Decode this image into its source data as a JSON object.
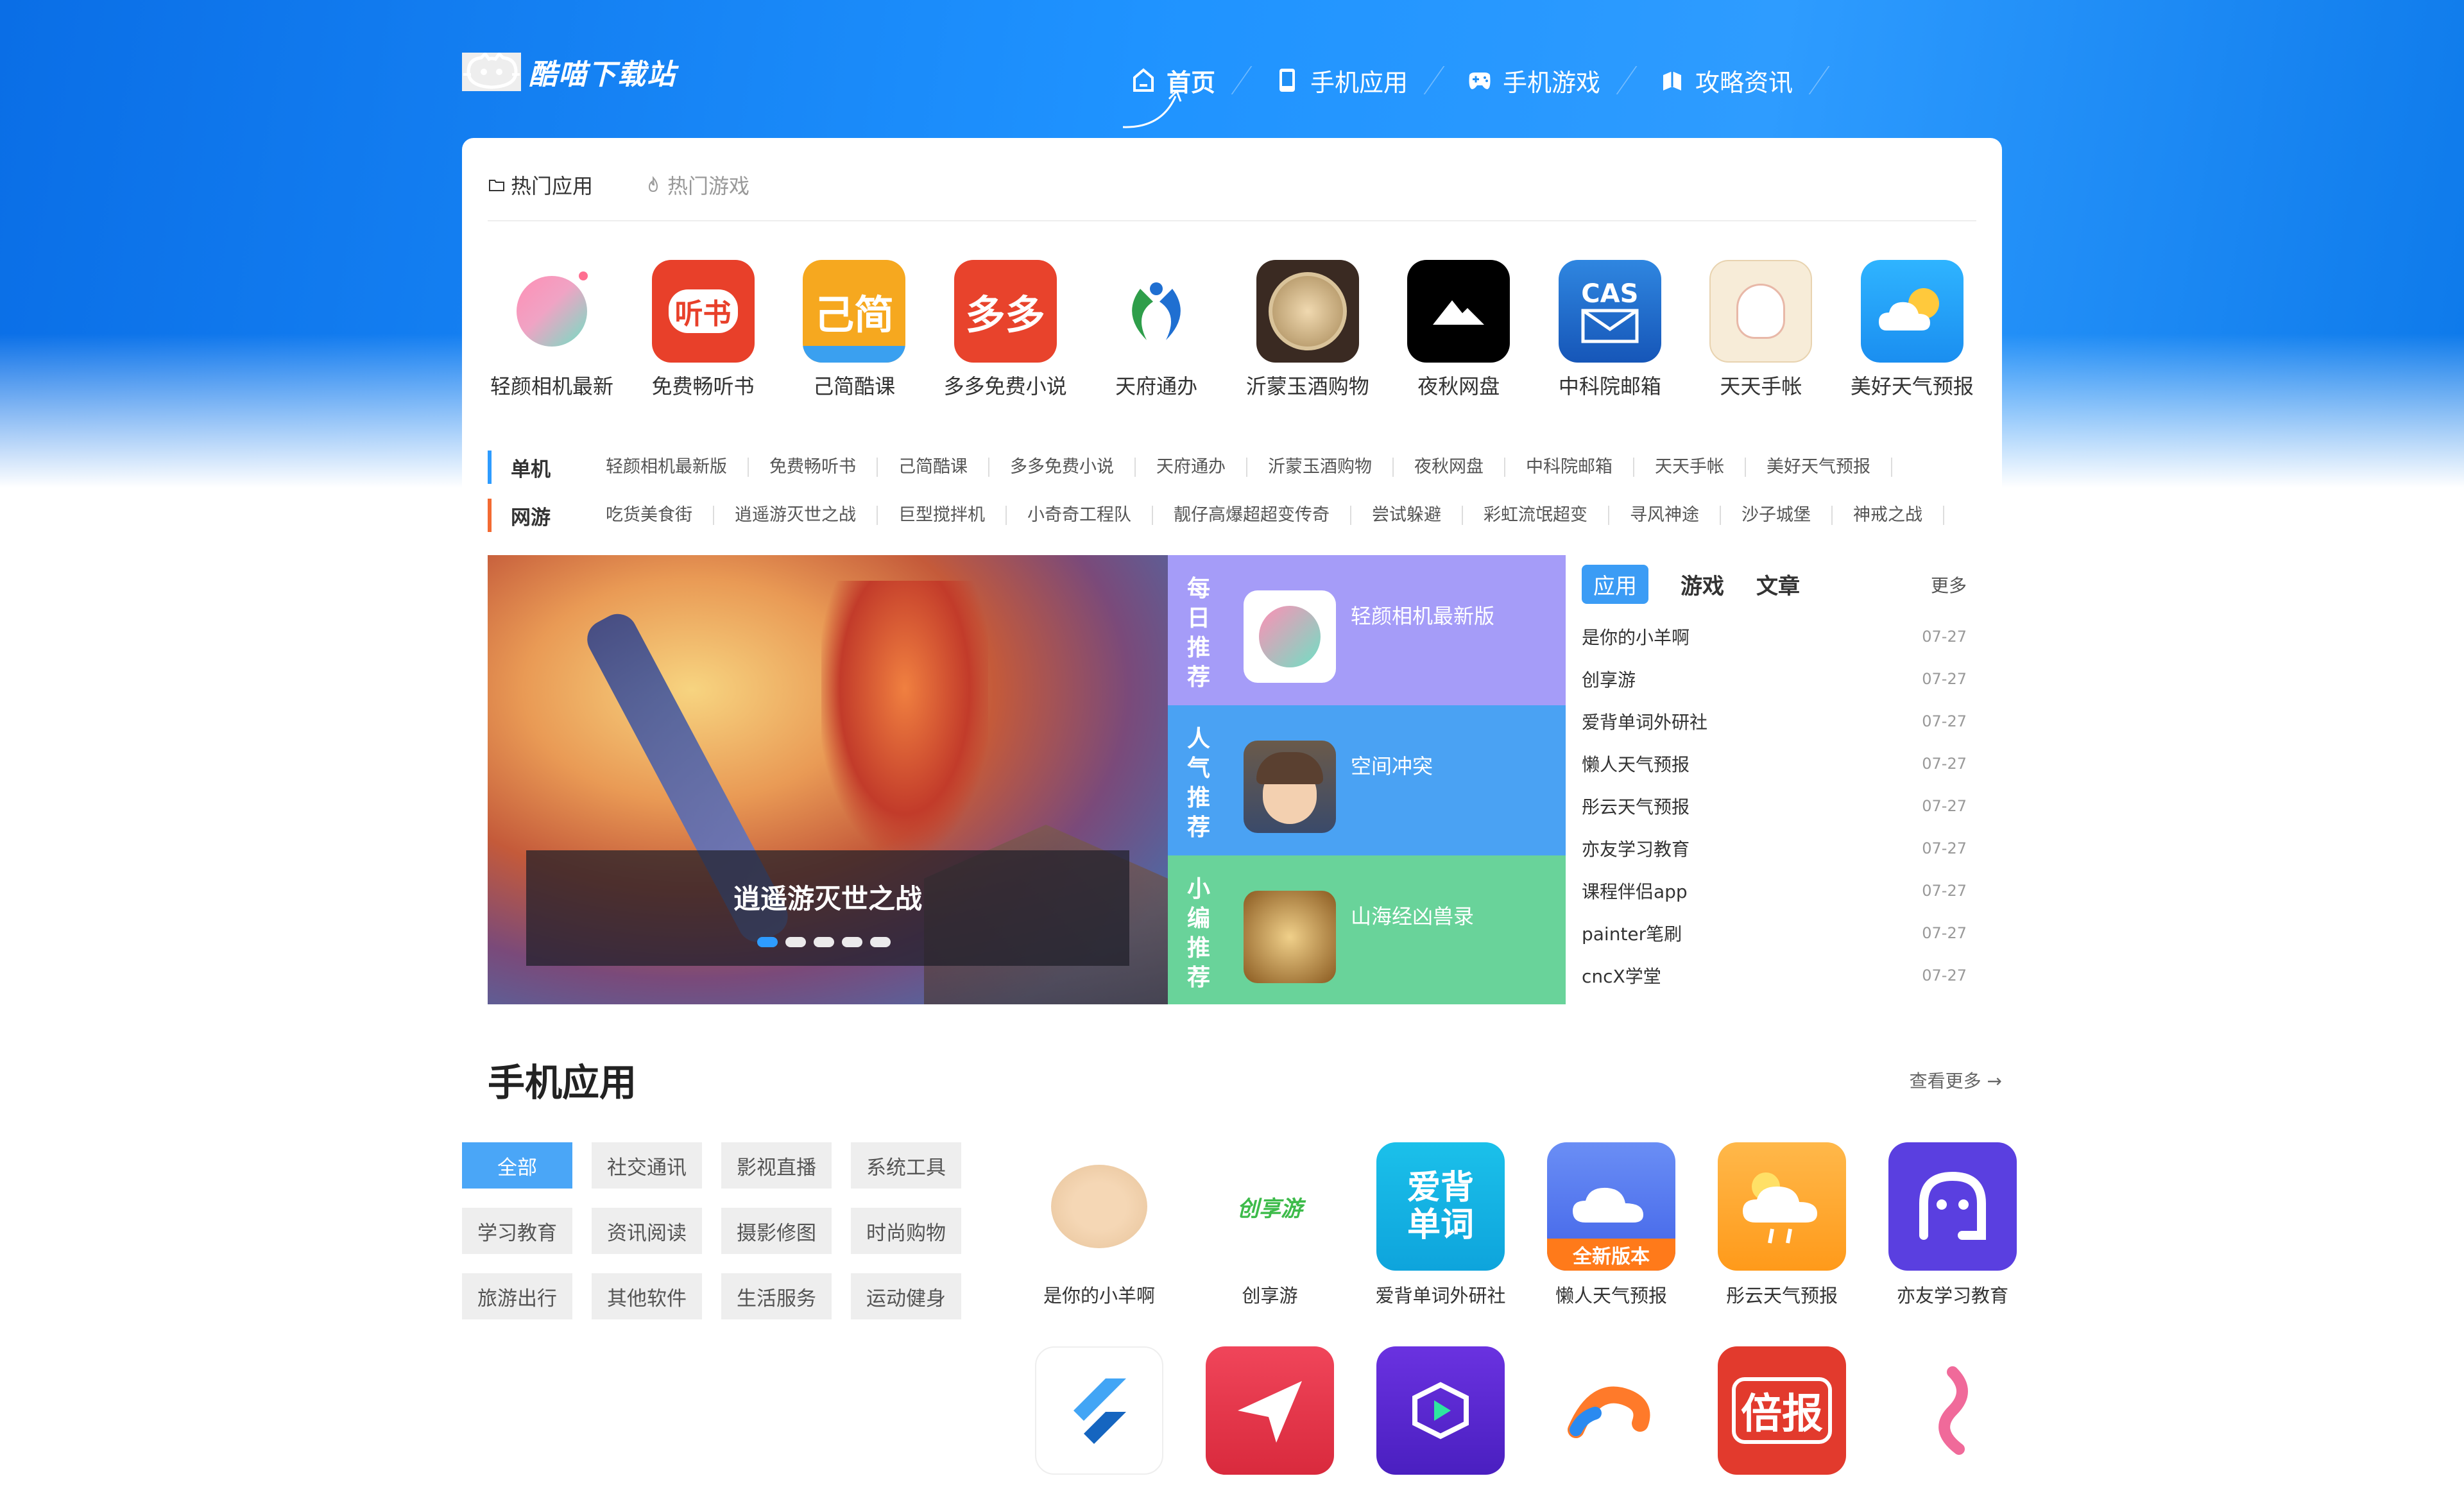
{
  "site": {
    "logo_text": "酷喵下载站"
  },
  "nav": [
    {
      "label": "首页",
      "icon": "home-icon"
    },
    {
      "label": "手机应用",
      "icon": "phone-icon"
    },
    {
      "label": "手机游戏",
      "icon": "gamepad-icon"
    },
    {
      "label": "攻略资讯",
      "icon": "book-icon"
    }
  ],
  "hot_tabs": [
    {
      "label": "热门应用",
      "icon": "folder-icon"
    },
    {
      "label": "热门游戏",
      "icon": "fire-icon"
    }
  ],
  "hot_apps": [
    {
      "label": "轻颜相机最新",
      "color": "#ffffff"
    },
    {
      "label": "免费畅听书",
      "color": "#e8402a",
      "glyph": "听书"
    },
    {
      "label": "己简酷课",
      "color": "#f6a81f",
      "glyph": "己简"
    },
    {
      "label": "多多免费小说",
      "color": "#e8432c",
      "glyph": "多多"
    },
    {
      "label": "天府通办",
      "color": "#ffffff"
    },
    {
      "label": "沂蒙玉酒购物",
      "color": "#3a2a22"
    },
    {
      "label": "夜秋网盘",
      "color": "#000000"
    },
    {
      "label": "中科院邮箱",
      "color": "#1f6fd1",
      "glyph": "CAS"
    },
    {
      "label": "天天手帐",
      "color": "#f7ecd8"
    },
    {
      "label": "美好天气预报",
      "color": "#1ea0f5"
    }
  ],
  "keywords": {
    "single": {
      "head": "单机",
      "accent": "#2e9cff",
      "items": [
        "轻颜相机最新版",
        "免费畅听书",
        "己简酷课",
        "多多免费小说",
        "天府通办",
        "沂蒙玉酒购物",
        "夜秋网盘",
        "中科院邮箱",
        "天天手帐",
        "美好天气预报"
      ]
    },
    "online": {
      "head": "网游",
      "accent": "#f36a32",
      "items": [
        "吃货美食街",
        "逍遥游灭世之战",
        "巨型搅拌机",
        "小奇奇工程队",
        "靓仔高爆超超变传奇",
        "尝试躲避",
        "彩虹流氓超变",
        "寻风神途",
        "沙子城堡",
        "神戒之战"
      ]
    }
  },
  "banner": {
    "title": "逍遥游灭世之战",
    "slides": 5,
    "active": 1
  },
  "recs": [
    {
      "vlabel": [
        "每",
        "日",
        "推",
        "荐"
      ],
      "name": "轻颜相机最新版",
      "color": "#a59cf8"
    },
    {
      "vlabel": [
        "人",
        "气",
        "推",
        "荐"
      ],
      "name": "空间冲突",
      "color": "#4aa2f3"
    },
    {
      "vlabel": [
        "小",
        "编",
        "推",
        "荐"
      ],
      "name": "山海经凶兽录",
      "color": "#69d39a"
    }
  ],
  "news": {
    "tabs": [
      "应用",
      "游戏",
      "文章"
    ],
    "more": "更多",
    "items": [
      {
        "title": "是你的小羊啊",
        "date": "07-27"
      },
      {
        "title": "创享游",
        "date": "07-27"
      },
      {
        "title": "爱背单词外研社",
        "date": "07-27"
      },
      {
        "title": "懒人天气预报",
        "date": "07-27"
      },
      {
        "title": "彤云天气预报",
        "date": "07-27"
      },
      {
        "title": "亦友学习教育",
        "date": "07-27"
      },
      {
        "title": "课程伴侣app",
        "date": "07-27"
      },
      {
        "title": "painter笔刷",
        "date": "07-27"
      },
      {
        "title": "cncX学堂",
        "date": "07-27"
      }
    ]
  },
  "mobile_apps": {
    "title": "手机应用",
    "more": "查看更多 →",
    "categories": [
      "全部",
      "社交通讯",
      "影视直播",
      "系统工具",
      "学习教育",
      "资讯阅读",
      "摄影修图",
      "时尚购物",
      "旅游出行",
      "其他软件",
      "生活服务",
      "运动健身"
    ],
    "apps": [
      {
        "label": "是你的小羊啊",
        "color": "#ffffff"
      },
      {
        "label": "创享游",
        "color": "#ffffff",
        "glyph": "创享游"
      },
      {
        "label": "爱背单词外研社",
        "color": "#1bb3e8",
        "glyph": "爱背单词"
      },
      {
        "label": "懒人天气预报",
        "color": "#4d7ff2",
        "glyph": "全新版本"
      },
      {
        "label": "彤云天气预报",
        "color": "#ffa726"
      },
      {
        "label": "亦友学习教育",
        "color": "#5a3fe0"
      },
      {
        "label": "",
        "color": "#ffffff"
      },
      {
        "label": "",
        "color": "#e8334a"
      },
      {
        "label": "",
        "color": "#5b2bd6"
      },
      {
        "label": "",
        "color": "#ffffff"
      },
      {
        "label": "",
        "color": "#e23a2d",
        "glyph": "倍报"
      },
      {
        "label": "",
        "color": "#ffffff"
      }
    ]
  }
}
